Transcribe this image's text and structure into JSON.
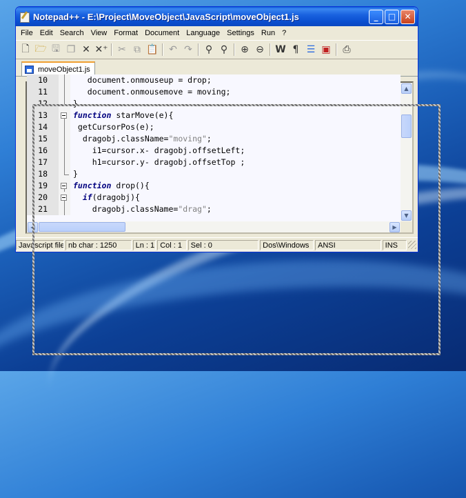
{
  "window": {
    "title": "Notepad++ - E:\\Project\\MoveObject\\JavaScript\\moveObject1.js",
    "controls": {
      "minimize": "_",
      "maximize": "□",
      "close": "✕"
    }
  },
  "menu": [
    "File",
    "Edit",
    "Search",
    "View",
    "Format",
    "Document",
    "Language",
    "Settings",
    "Run",
    "?"
  ],
  "toolbar": {
    "icons": [
      "new-file-icon",
      "open-file-icon",
      "save-icon",
      "save-all-icon",
      "close-icon",
      "close-all-icon",
      "cut-icon",
      "copy-icon",
      "paste-icon",
      "undo-icon",
      "redo-icon",
      "find-icon",
      "replace-icon",
      "zoom-in-icon",
      "zoom-out-icon",
      "wrap-icon",
      "show-all-chars-icon",
      "indent-guide-icon",
      "user-lang-icon",
      "print-icon"
    ]
  },
  "tab": {
    "label": "moveObject1.js"
  },
  "editor": {
    "lines": [
      {
        "num": "10",
        "fold": "line",
        "parts": [
          {
            "t": "   document.onmouseup = drop;",
            "c": ""
          }
        ]
      },
      {
        "num": "11",
        "fold": "line",
        "parts": [
          {
            "t": "   document.onmousemove = moving;",
            "c": ""
          }
        ]
      },
      {
        "num": "12",
        "fold": "end",
        "parts": [
          {
            "t": "}",
            "c": ""
          }
        ]
      },
      {
        "num": "13",
        "fold": "box",
        "parts": [
          {
            "t": "function",
            "c": "kw"
          },
          {
            "t": " starMove(e){",
            "c": ""
          }
        ]
      },
      {
        "num": "14",
        "fold": "line",
        "parts": [
          {
            "t": " getCursorPos(e);",
            "c": ""
          }
        ]
      },
      {
        "num": "15",
        "fold": "line",
        "parts": [
          {
            "t": "  dragobj.className=",
            "c": ""
          },
          {
            "t": "\"moving\"",
            "c": "str"
          },
          {
            "t": ";",
            "c": ""
          }
        ]
      },
      {
        "num": "16",
        "fold": "line",
        "parts": [
          {
            "t": "    i1=cursor.x- dragobj.offsetLeft;",
            "c": ""
          }
        ]
      },
      {
        "num": "17",
        "fold": "line",
        "parts": [
          {
            "t": "    h1=cursor.y- dragobj.offsetTop ;",
            "c": ""
          }
        ]
      },
      {
        "num": "18",
        "fold": "end",
        "parts": [
          {
            "t": "}",
            "c": ""
          }
        ]
      },
      {
        "num": "19",
        "fold": "box",
        "parts": [
          {
            "t": "function",
            "c": "kw"
          },
          {
            "t": " drop(){",
            "c": ""
          }
        ]
      },
      {
        "num": "20",
        "fold": "box",
        "parts": [
          {
            "t": "  ",
            "c": ""
          },
          {
            "t": "if",
            "c": "kw"
          },
          {
            "t": "(dragobj){",
            "c": ""
          }
        ]
      },
      {
        "num": "21",
        "fold": "line",
        "parts": [
          {
            "t": "    dragobj.className=",
            "c": ""
          },
          {
            "t": "\"drag\"",
            "c": "str"
          },
          {
            "t": ";",
            "c": ""
          }
        ]
      }
    ]
  },
  "status": {
    "file_type": "Javascript file",
    "nb_char": "nb char : 1250",
    "ln": "Ln : 1",
    "col": "Col : 1",
    "sel": "Sel : 0",
    "eol": "Dos\\Windows",
    "encoding": "ANSI",
    "mode": "INS"
  }
}
